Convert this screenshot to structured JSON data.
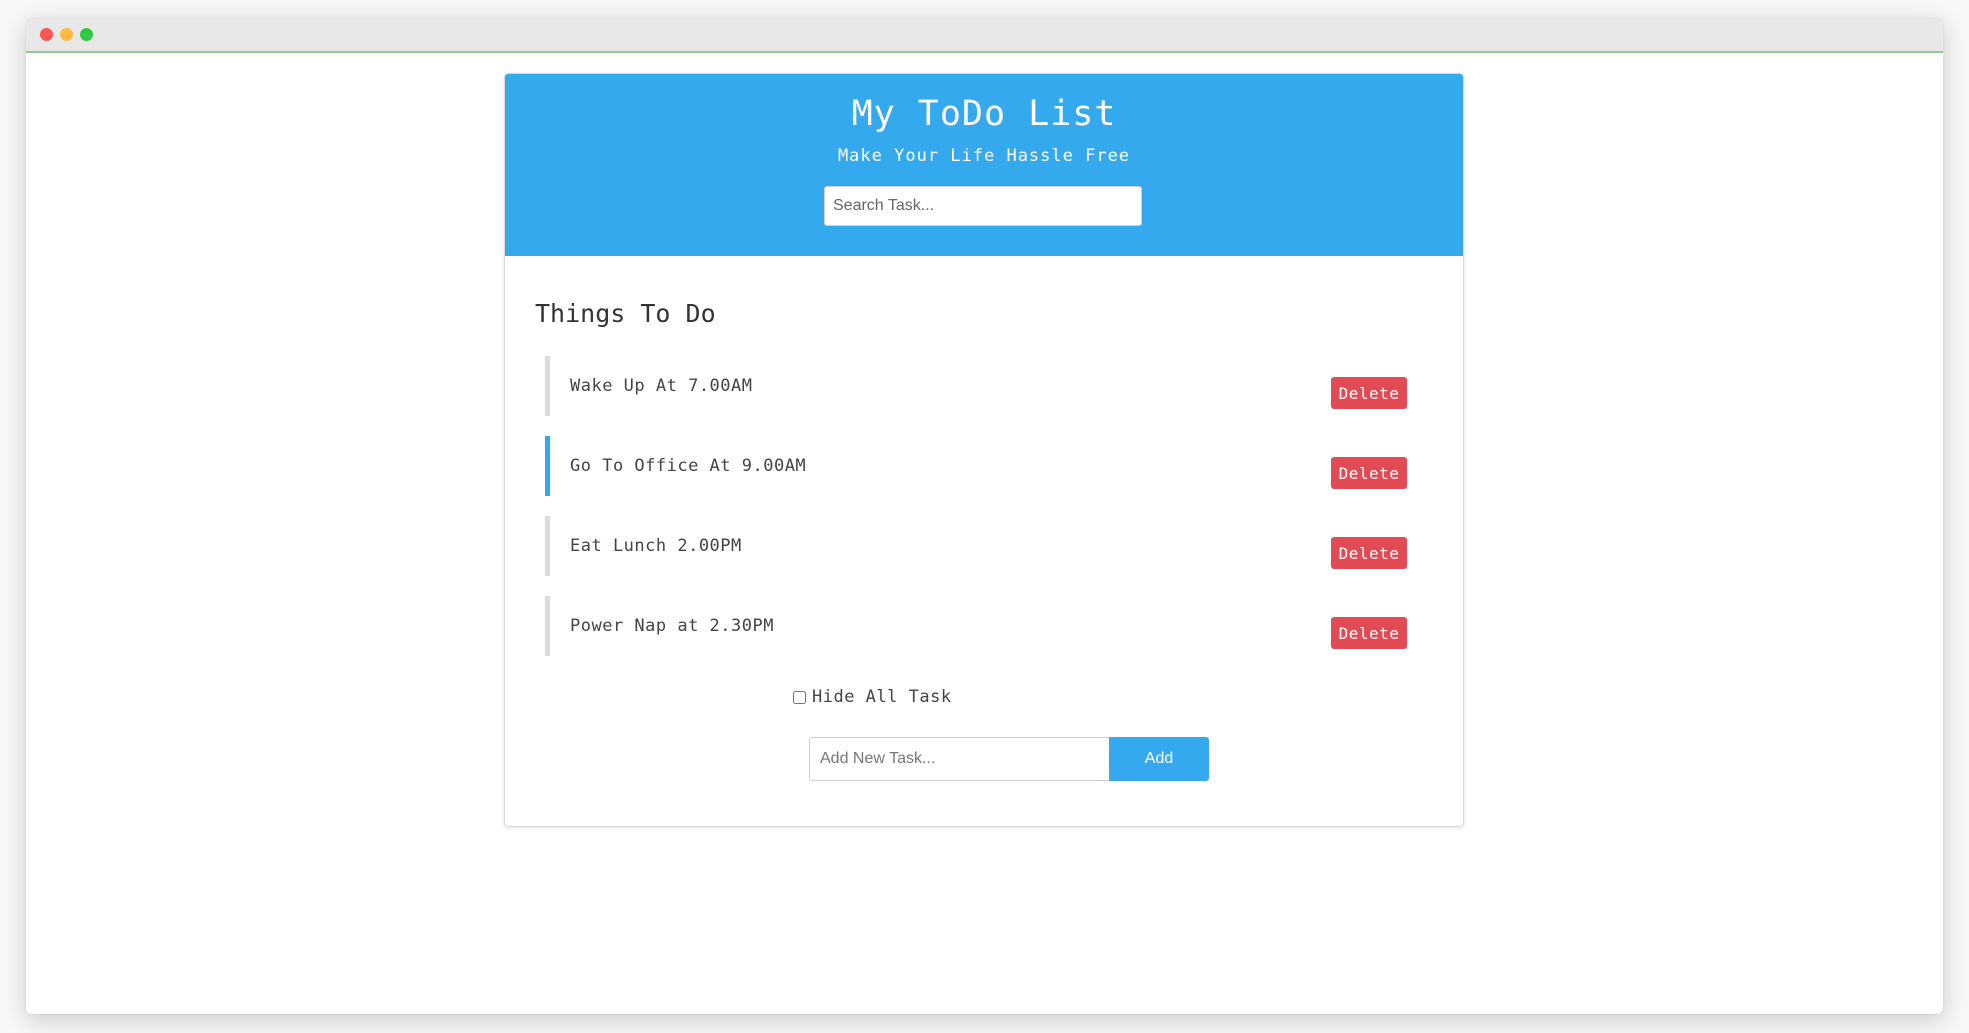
{
  "window": {
    "controls": [
      "close",
      "minimize",
      "maximize"
    ]
  },
  "header": {
    "title": "My ToDo List",
    "subtitle": "Make Your Life Hassle Free",
    "search_placeholder": "Search Task..."
  },
  "section": {
    "title": "Things To Do"
  },
  "tasks": [
    {
      "name": "Wake Up At 7.00AM",
      "delete_label": "Delete"
    },
    {
      "name": "Go To Office At 9.00AM",
      "delete_label": "Delete",
      "highlighted": true
    },
    {
      "name": "Eat Lunch 2.00PM",
      "delete_label": "Delete"
    },
    {
      "name": "Power Nap at 2.30PM",
      "delete_label": "Delete"
    }
  ],
  "hide_all": {
    "label": "Hide All Task",
    "checked": false
  },
  "add_form": {
    "placeholder": "Add New Task...",
    "button_label": "Add"
  },
  "colors": {
    "primary": "#35a9ee",
    "delete": "#e24a54",
    "inactive_border": "#dcdcdc"
  }
}
